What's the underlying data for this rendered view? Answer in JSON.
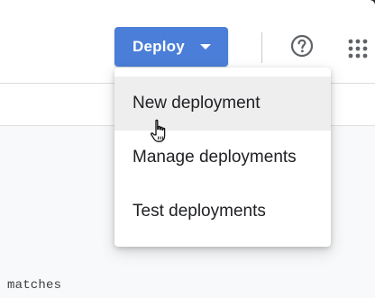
{
  "header": {
    "deploy_button": {
      "label": "Deploy",
      "color": "#4a7ed8"
    },
    "help_icon": "help-circle-icon",
    "apps_icon": "apps-grid-icon"
  },
  "deploy_menu": {
    "items": [
      {
        "label": "New deployment",
        "state": "hover"
      },
      {
        "label": "Manage deployments",
        "state": "normal"
      },
      {
        "label": "Test deployments",
        "state": "normal"
      }
    ]
  },
  "editor": {
    "visible_text": "matches"
  }
}
